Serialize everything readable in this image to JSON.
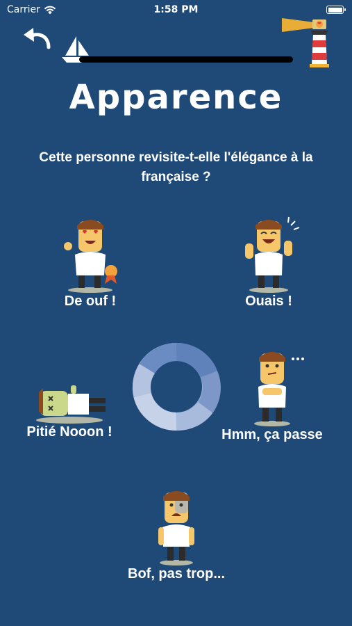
{
  "status": {
    "carrier": "Carrier",
    "time": "1:58 PM"
  },
  "progress": {
    "value": 0.0
  },
  "page": {
    "title": "Apparence",
    "question": "Cette personne revisite-t-elle l'élégance à la française ?"
  },
  "options": [
    {
      "label": "De ouf !",
      "icon": "heart-eyes-character-icon"
    },
    {
      "label": "Ouais !",
      "icon": "happy-character-icon"
    },
    {
      "label": "Hmm, ça passe",
      "icon": "thinking-character-icon"
    },
    {
      "label": "Pitié Nooon !",
      "icon": "fainted-character-icon"
    },
    {
      "label": "Bof, pas trop...",
      "icon": "disappointed-character-icon"
    }
  ],
  "colors": {
    "background": "#1f4a78",
    "accent": "#f2b233",
    "donut": "#5f82bb"
  }
}
